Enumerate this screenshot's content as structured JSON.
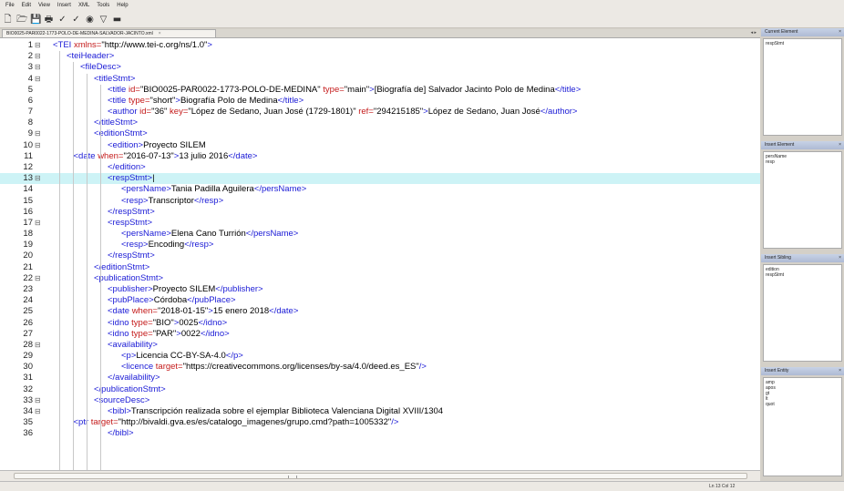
{
  "menu": [
    "File",
    "Edit",
    "View",
    "Insert",
    "XML",
    "Tools",
    "Help"
  ],
  "toolbar": [
    {
      "name": "new-file-icon",
      "glyph": "🗋"
    },
    {
      "name": "open-folder-icon",
      "glyph": "🗁"
    },
    {
      "name": "save-icon",
      "glyph": "💾"
    },
    {
      "name": "print-icon",
      "glyph": "🖶"
    },
    {
      "name": "check-wellformed-icon",
      "glyph": "✓"
    },
    {
      "name": "validate-icon",
      "glyph": "✓"
    },
    {
      "name": "browser-icon",
      "glyph": "◉"
    },
    {
      "name": "filter-icon",
      "glyph": "▽"
    },
    {
      "name": "minus-icon",
      "glyph": "▬"
    }
  ],
  "tab": {
    "label": "BIO0025-PAR0022-1773-POLO-DE-MEDINA-SALVADOR-JACINTO.xml",
    "close": "×"
  },
  "tab_controls": "◂ ▸",
  "editor": {
    "highlighted_line": 13,
    "lines": [
      {
        "n": 1,
        "fold": "⊟",
        "indent": 0,
        "tokens": [
          [
            "t",
            "<TEI "
          ],
          [
            "a",
            "xmlns="
          ],
          [
            "v",
            "\"http://www.tei-c.org/ns/1.0\""
          ],
          [
            "t",
            ">"
          ]
        ]
      },
      {
        "n": 2,
        "fold": "⊟",
        "indent": 1,
        "tokens": [
          [
            "t",
            "<teiHeader>"
          ]
        ]
      },
      {
        "n": 3,
        "fold": "⊟",
        "indent": 2,
        "tokens": [
          [
            "t",
            "<fileDesc>"
          ]
        ]
      },
      {
        "n": 4,
        "fold": "⊟",
        "indent": 3,
        "tokens": [
          [
            "t",
            "<titleStmt>"
          ]
        ]
      },
      {
        "n": 5,
        "fold": "",
        "indent": 4,
        "tokens": [
          [
            "t",
            "<title "
          ],
          [
            "a",
            "id="
          ],
          [
            "v",
            "\"BIO0025-PAR0022-1773-POLO-DE-MEDINA\" "
          ],
          [
            "a",
            "type="
          ],
          [
            "v",
            "\"main\""
          ],
          [
            "t",
            ">"
          ],
          [
            "v",
            "[Biografía de] Salvador Jacinto Polo de Medina"
          ],
          [
            "t",
            "</title>"
          ]
        ]
      },
      {
        "n": 6,
        "fold": "",
        "indent": 4,
        "tokens": [
          [
            "t",
            "<title "
          ],
          [
            "a",
            "type="
          ],
          [
            "v",
            "\"short\""
          ],
          [
            "t",
            ">"
          ],
          [
            "v",
            "Biografía Polo de Medina"
          ],
          [
            "t",
            "</title>"
          ]
        ]
      },
      {
        "n": 7,
        "fold": "",
        "indent": 4,
        "tokens": [
          [
            "t",
            "<author "
          ],
          [
            "a",
            "id="
          ],
          [
            "v",
            "\"36\" "
          ],
          [
            "a",
            "key="
          ],
          [
            "v",
            "\"López de Sedano, Juan José (1729-1801)\" "
          ],
          [
            "a",
            "ref="
          ],
          [
            "v",
            "\"294215185\""
          ],
          [
            "t",
            ">"
          ],
          [
            "v",
            "López de Sedano, Juan José"
          ],
          [
            "t",
            "</author>"
          ]
        ]
      },
      {
        "n": 8,
        "fold": "",
        "indent": 3,
        "tokens": [
          [
            "t",
            "</titleStmt>"
          ]
        ]
      },
      {
        "n": 9,
        "fold": "⊟",
        "indent": 3,
        "tokens": [
          [
            "t",
            "<editionStmt>"
          ]
        ]
      },
      {
        "n": 10,
        "fold": "⊟",
        "indent": 4,
        "tokens": [
          [
            "t",
            "<edition>"
          ],
          [
            "v",
            "Proyecto SILEM"
          ]
        ]
      },
      {
        "n": 11,
        "fold": "",
        "indent": 1.5,
        "tokens": [
          [
            "t",
            "<date "
          ],
          [
            "a",
            "when="
          ],
          [
            "v",
            "\"2016-07-13\""
          ],
          [
            "t",
            ">"
          ],
          [
            "v",
            "13 julio 2016"
          ],
          [
            "t",
            "</date>"
          ]
        ]
      },
      {
        "n": 12,
        "fold": "",
        "indent": 4,
        "tokens": [
          [
            "t",
            "</edition>"
          ]
        ]
      },
      {
        "n": 13,
        "fold": "⊟",
        "indent": 4,
        "tokens": [
          [
            "t",
            "<respStmt>"
          ],
          [
            "v",
            "|"
          ]
        ]
      },
      {
        "n": 14,
        "fold": "",
        "indent": 5,
        "tokens": [
          [
            "t",
            "<persName>"
          ],
          [
            "v",
            "Tania Padilla Aguilera"
          ],
          [
            "t",
            "</persName>"
          ]
        ]
      },
      {
        "n": 15,
        "fold": "",
        "indent": 5,
        "tokens": [
          [
            "t",
            "<resp>"
          ],
          [
            "v",
            "Transcriptor"
          ],
          [
            "t",
            "</resp>"
          ]
        ]
      },
      {
        "n": 16,
        "fold": "",
        "indent": 4,
        "tokens": [
          [
            "t",
            "</respStmt>"
          ]
        ]
      },
      {
        "n": 17,
        "fold": "⊟",
        "indent": 4,
        "tokens": [
          [
            "t",
            "<respStmt>"
          ]
        ]
      },
      {
        "n": 18,
        "fold": "",
        "indent": 5,
        "tokens": [
          [
            "t",
            "<persName>"
          ],
          [
            "v",
            "Elena Cano Turrión"
          ],
          [
            "t",
            "</persName>"
          ]
        ]
      },
      {
        "n": 19,
        "fold": "",
        "indent": 5,
        "tokens": [
          [
            "t",
            "<resp>"
          ],
          [
            "v",
            "Encoding"
          ],
          [
            "t",
            "</resp>"
          ]
        ]
      },
      {
        "n": 20,
        "fold": "",
        "indent": 4,
        "tokens": [
          [
            "t",
            "</respStmt>"
          ]
        ]
      },
      {
        "n": 21,
        "fold": "",
        "indent": 3,
        "tokens": [
          [
            "t",
            "</editionStmt>"
          ]
        ]
      },
      {
        "n": 22,
        "fold": "⊟",
        "indent": 3,
        "tokens": [
          [
            "t",
            "<publicationStmt>"
          ]
        ]
      },
      {
        "n": 23,
        "fold": "",
        "indent": 4,
        "tokens": [
          [
            "t",
            "<publisher>"
          ],
          [
            "v",
            "Proyecto SILEM"
          ],
          [
            "t",
            "</publisher>"
          ]
        ]
      },
      {
        "n": 24,
        "fold": "",
        "indent": 4,
        "tokens": [
          [
            "t",
            "<pubPlace>"
          ],
          [
            "v",
            "Córdoba"
          ],
          [
            "t",
            "</pubPlace>"
          ]
        ]
      },
      {
        "n": 25,
        "fold": "",
        "indent": 4,
        "tokens": [
          [
            "t",
            "<date "
          ],
          [
            "a",
            "when="
          ],
          [
            "v",
            "\"2018-01-15\""
          ],
          [
            "t",
            ">"
          ],
          [
            "v",
            "15 enero 2018"
          ],
          [
            "t",
            "</date>"
          ]
        ]
      },
      {
        "n": 26,
        "fold": "",
        "indent": 4,
        "tokens": [
          [
            "t",
            "<idno "
          ],
          [
            "a",
            "type="
          ],
          [
            "v",
            "\"BIO\""
          ],
          [
            "t",
            ">"
          ],
          [
            "v",
            "0025"
          ],
          [
            "t",
            "</idno>"
          ]
        ]
      },
      {
        "n": 27,
        "fold": "",
        "indent": 4,
        "tokens": [
          [
            "t",
            "<idno "
          ],
          [
            "a",
            "type="
          ],
          [
            "v",
            "\"PAR\""
          ],
          [
            "t",
            ">"
          ],
          [
            "v",
            "0022"
          ],
          [
            "t",
            "</idno>"
          ]
        ]
      },
      {
        "n": 28,
        "fold": "⊟",
        "indent": 4,
        "tokens": [
          [
            "t",
            "<availability>"
          ]
        ]
      },
      {
        "n": 29,
        "fold": "",
        "indent": 5,
        "tokens": [
          [
            "t",
            "<p>"
          ],
          [
            "v",
            "Licencia CC-BY-SA-4.0"
          ],
          [
            "t",
            "</p>"
          ]
        ]
      },
      {
        "n": 30,
        "fold": "",
        "indent": 5,
        "tokens": [
          [
            "t",
            "<licence "
          ],
          [
            "a",
            "target="
          ],
          [
            "v",
            "\"https://creativecommons.org/licenses/by-sa/4.0/deed.es_ES\""
          ],
          [
            "t",
            "/>"
          ]
        ]
      },
      {
        "n": 31,
        "fold": "",
        "indent": 4,
        "tokens": [
          [
            "t",
            "</availability>"
          ]
        ]
      },
      {
        "n": 32,
        "fold": "",
        "indent": 3,
        "tokens": [
          [
            "t",
            "</publicationStmt>"
          ]
        ]
      },
      {
        "n": 33,
        "fold": "⊟",
        "indent": 3,
        "tokens": [
          [
            "t",
            "<sourceDesc>"
          ]
        ]
      },
      {
        "n": 34,
        "fold": "⊟",
        "indent": 4,
        "tokens": [
          [
            "t",
            "<bibl>"
          ],
          [
            "v",
            "Transcripción realizada sobre el ejemplar Biblioteca Valenciana Digital XVIII/1304"
          ]
        ]
      },
      {
        "n": 35,
        "fold": "",
        "indent": 1.5,
        "tokens": [
          [
            "t",
            "<ptr "
          ],
          [
            "a",
            "target="
          ],
          [
            "v",
            "\"http://bivaldi.gva.es/es/catalogo_imagenes/grupo.cmd?path=1005332\""
          ],
          [
            "t",
            "/>"
          ]
        ]
      },
      {
        "n": 36,
        "fold": "",
        "indent": 4,
        "tokens": [
          [
            "t",
            "</bibl>"
          ]
        ]
      }
    ]
  },
  "status": {
    "position": "Ln 13 Col 12"
  },
  "panels": [
    {
      "title": "Current Element",
      "items": [
        "respStmt"
      ],
      "close": "×"
    },
    {
      "title": "Insert Element",
      "items": [
        "persName",
        "resp"
      ],
      "close": "×"
    },
    {
      "title": "Insert Sibling",
      "items": [
        "edition",
        "respStmt"
      ],
      "close": "×"
    },
    {
      "title": "Insert Entity",
      "items": [
        "amp",
        "apos",
        "gt",
        "lt",
        "quot"
      ],
      "close": "×"
    }
  ]
}
